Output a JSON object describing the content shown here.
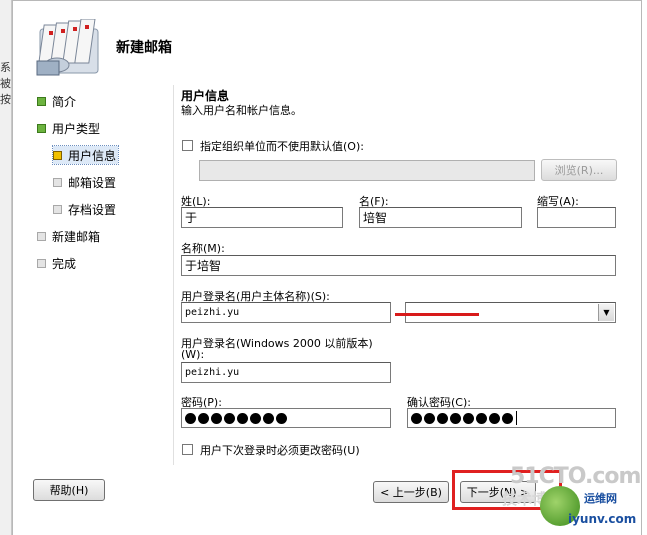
{
  "background_window": {
    "chars": [
      "系",
      "被",
      "按"
    ]
  },
  "wizard": {
    "title": "新建邮箱"
  },
  "nav": {
    "items": [
      {
        "label": "简介",
        "state": "done"
      },
      {
        "label": "用户类型",
        "state": "done"
      },
      {
        "label": "用户信息",
        "state": "current"
      },
      {
        "label": "邮箱设置",
        "state": "todo"
      },
      {
        "label": "存档设置",
        "state": "todo"
      },
      {
        "label": "新建邮箱",
        "state": "todo"
      },
      {
        "label": "完成",
        "state": "todo"
      }
    ]
  },
  "content": {
    "section_title": "用户信息",
    "section_subtitle": "输入用户名和帐户信息。",
    "ou_checkbox_label": "指定组织单位而不使用默认值(O):",
    "ou_path_value": "",
    "browse_label": "浏览(R)...",
    "last_name_label": "姓(L):",
    "last_name_value": "于",
    "first_name_label": "名(F):",
    "first_name_value": "培智",
    "initials_label": "缩写(A):",
    "initials_value": "",
    "name_label": "名称(M):",
    "name_value": "于培智",
    "upn_label": "用户登录名(用户主体名称)(S):",
    "upn_value": "peizhi.yu",
    "domain_value": "",
    "pre2000_label_1": "用户登录名(Windows 2000 以前版本)",
    "pre2000_label_2": "(W):",
    "pre2000_value": "peizhi.yu",
    "password_label": "密码(P):",
    "password_dots": 8,
    "confirm_label": "确认密码(C):",
    "confirm_dots": 8,
    "change_pwd_label": "用户下次登录时必须更改密码(U)"
  },
  "footer": {
    "help_label": "帮助(H)",
    "back_label": "< 上一步(B)",
    "next_label": "下一步(N) >"
  },
  "watermark": {
    "top": "51CTO.com",
    "sub": "技术博客",
    "url": "iyunv.com",
    "brand": "运维网"
  },
  "colors": {
    "done": "#6cb33f",
    "current": "#f0c000",
    "annotation_red": "#e02020"
  }
}
